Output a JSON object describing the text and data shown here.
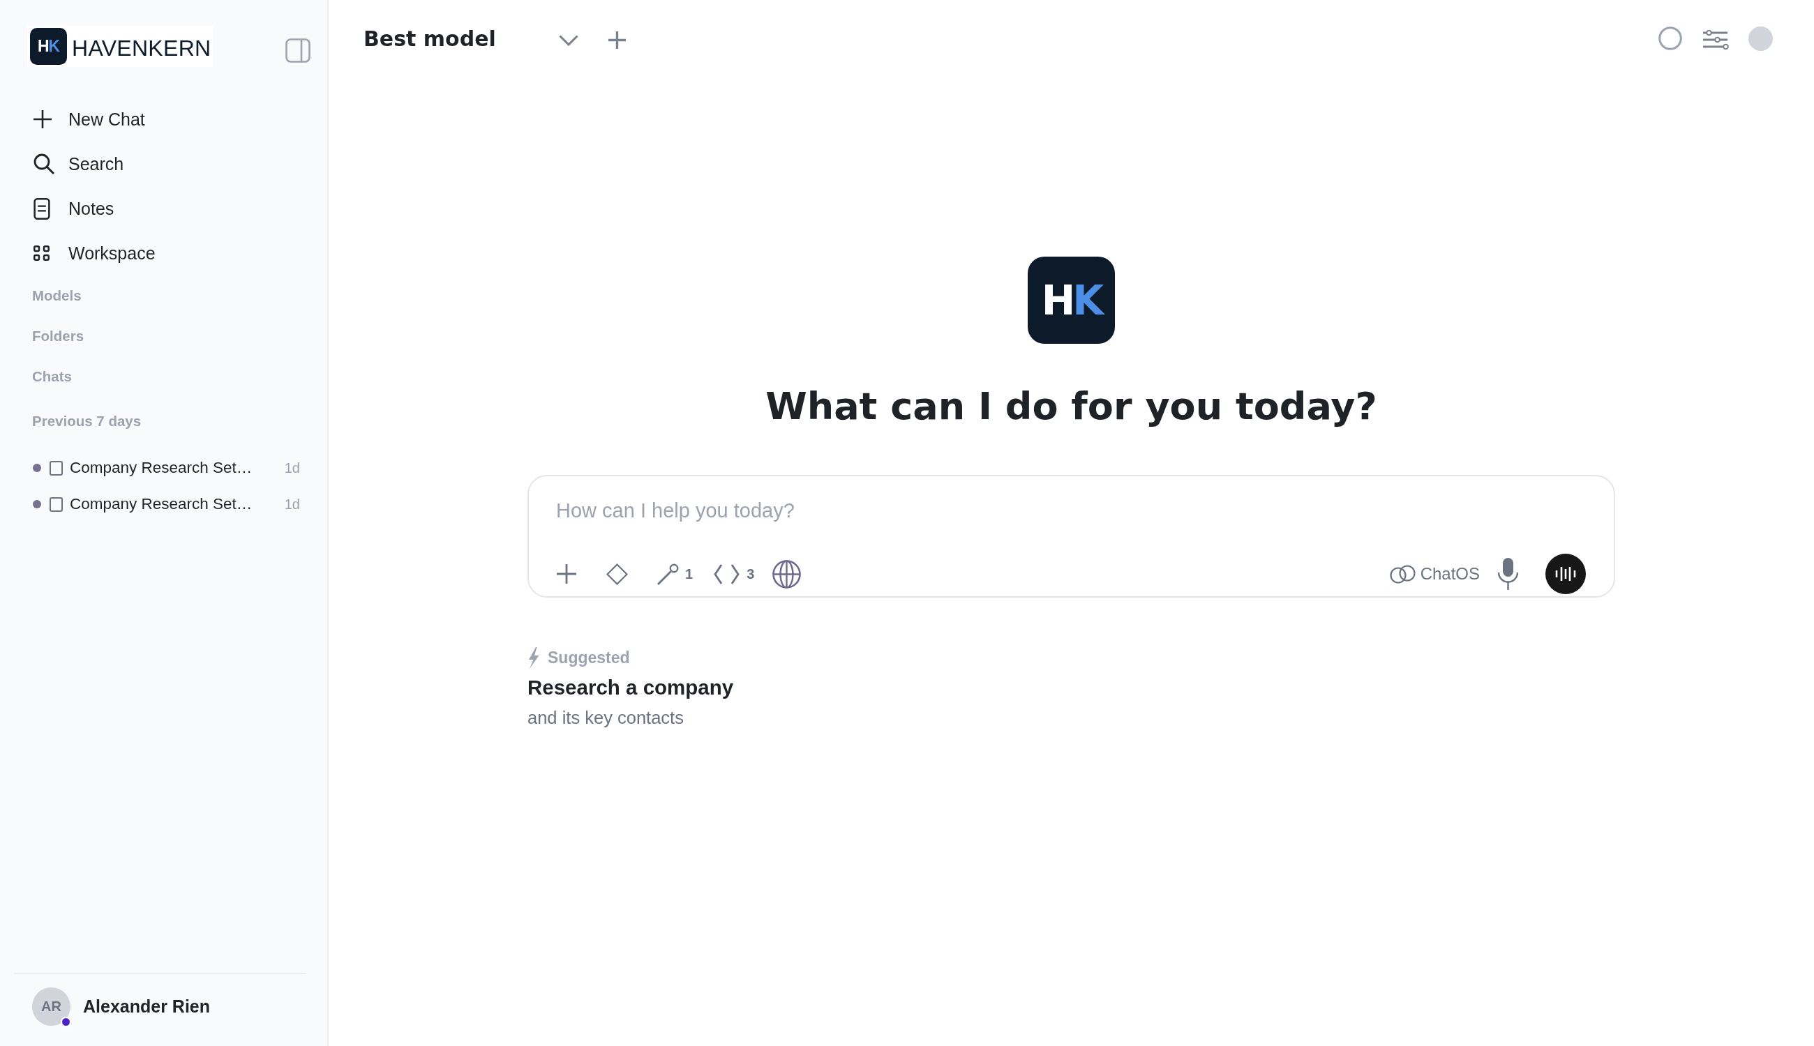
{
  "sidebar": {
    "logo": {
      "mark": [
        "H",
        "K"
      ],
      "name": "HAVENKERN"
    },
    "nav": [
      {
        "kind": "new",
        "label": "New Chat"
      },
      {
        "kind": "search",
        "label": "Search"
      },
      {
        "kind": "notes",
        "label": "Notes"
      },
      {
        "kind": "workspace",
        "label": "Workspace"
      }
    ],
    "sections": [
      {
        "label": "Models"
      },
      {
        "label": "Folders"
      },
      {
        "label": "Chats"
      }
    ],
    "chat_groups": [
      {
        "label": "Previous 7 days",
        "chats": [
          {
            "title": "Company Research Set…",
            "checked": false,
            "age": "1d"
          },
          {
            "title": "Company Research Set…",
            "checked": false,
            "age": "1d"
          }
        ]
      }
    ],
    "user": {
      "initials": "AR",
      "name": "Alexander Rien",
      "online": true
    }
  },
  "top_bar": {
    "model": "Best model"
  },
  "welcome": {
    "mark": [
      "H",
      "K"
    ],
    "heading": "What can I do for you today?"
  },
  "composer": {
    "placeholder": "How can I help you today?",
    "tools": [
      {
        "kind": "add"
      },
      {
        "kind": "diamond"
      },
      {
        "kind": "tools",
        "count": "1"
      },
      {
        "kind": "code",
        "count": "3"
      },
      {
        "kind": "web"
      }
    ],
    "model_chip": "ChatOS"
  },
  "suggestion": {
    "label": "Suggested",
    "title": "Research a company",
    "subtitle": "and its key contacts"
  }
}
